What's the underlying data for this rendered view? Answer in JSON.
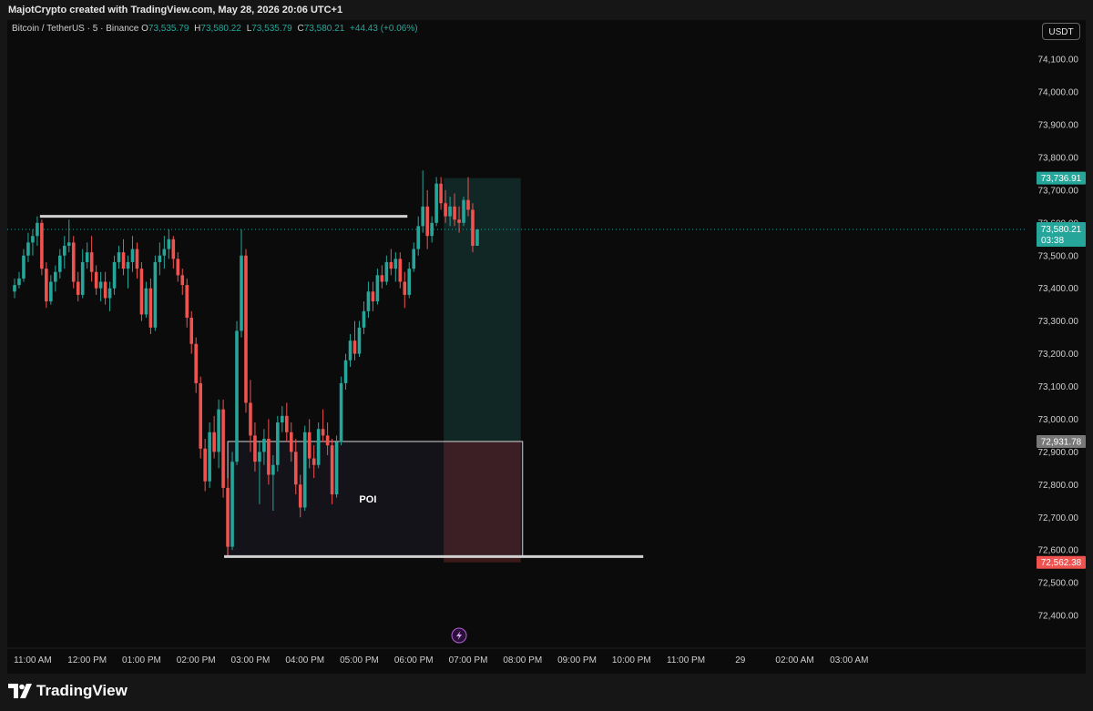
{
  "header": {
    "attribution": "MajotCrypto created with TradingView.com, May 28, 2026 20:06 UTC+1"
  },
  "legend": {
    "symbol": "Bitcoin / TetherUS · 5 · Binance",
    "open_label": "O",
    "open": "73,535.79",
    "high_label": "H",
    "high": "73,580.22",
    "low_label": "L",
    "low": "73,535.79",
    "close_label": "C",
    "close": "73,580.21",
    "change": "+44.43 (+0.06%)"
  },
  "currency_button": "USDT",
  "footer": {
    "brand": "TradingView"
  },
  "colors": {
    "up": "#26a69a",
    "down": "#ef5350",
    "background": "#0b0b0b",
    "axis_text": "#cfcfcf"
  },
  "chart_data": {
    "type": "candlestick",
    "ylim": [
      72300,
      74220
    ],
    "y_ticks": [
      74100,
      74000,
      73900,
      73800,
      73700,
      73600,
      73500,
      73400,
      73300,
      73200,
      73100,
      73000,
      72900,
      72800,
      72700,
      72600,
      72500,
      72400
    ],
    "y_tick_labels": [
      "74,100.00",
      "74,000.00",
      "73,900.00",
      "73,800.00",
      "73,700.00",
      "73,600.00",
      "73,500.00",
      "73,400.00",
      "73,300.00",
      "73,200.00",
      "73,100.00",
      "73,000.00",
      "72,900.00",
      "72,800.00",
      "72,700.00",
      "72,600.00",
      "72,500.00",
      "72,400.00"
    ],
    "x_ticks": [
      "11:00 AM",
      "12:00 PM",
      "01:00 PM",
      "02:00 PM",
      "03:00 PM",
      "04:00 PM",
      "05:00 PM",
      "06:00 PM",
      "07:00 PM",
      "08:00 PM",
      "09:00 PM",
      "10:00 PM",
      "11:00 PM",
      "29",
      "02:00 AM",
      "03:00 AM"
    ],
    "interval": "5m",
    "start_time": "10:40 AM",
    "candles": [
      [
        73390,
        73430,
        73370,
        73410
      ],
      [
        73410,
        73450,
        73400,
        73430
      ],
      [
        73430,
        73520,
        73420,
        73500
      ],
      [
        73500,
        73570,
        73480,
        73540
      ],
      [
        73540,
        73580,
        73500,
        73560
      ],
      [
        73560,
        73620,
        73530,
        73600
      ],
      [
        73600,
        73610,
        73440,
        73460
      ],
      [
        73460,
        73480,
        73340,
        73360
      ],
      [
        73360,
        73440,
        73350,
        73420
      ],
      [
        73420,
        73470,
        73390,
        73450
      ],
      [
        73450,
        73520,
        73430,
        73500
      ],
      [
        73500,
        73560,
        73460,
        73530
      ],
      [
        73530,
        73610,
        73510,
        73540
      ],
      [
        73540,
        73560,
        73400,
        73420
      ],
      [
        73420,
        73450,
        73360,
        73380
      ],
      [
        73380,
        73520,
        73370,
        73480
      ],
      [
        73480,
        73540,
        73460,
        73510
      ],
      [
        73510,
        73560,
        73420,
        73450
      ],
      [
        73450,
        73470,
        73380,
        73400
      ],
      [
        73400,
        73450,
        73360,
        73420
      ],
      [
        73420,
        73450,
        73350,
        73370
      ],
      [
        73370,
        73420,
        73330,
        73400
      ],
      [
        73400,
        73500,
        73380,
        73480
      ],
      [
        73480,
        73530,
        73460,
        73510
      ],
      [
        73510,
        73550,
        73440,
        73460
      ],
      [
        73460,
        73500,
        73400,
        73480
      ],
      [
        73480,
        73560,
        73450,
        73520
      ],
      [
        73520,
        73540,
        73430,
        73460
      ],
      [
        73460,
        73480,
        73300,
        73320
      ],
      [
        73320,
        73420,
        73310,
        73400
      ],
      [
        73400,
        73430,
        73260,
        73280
      ],
      [
        73280,
        73500,
        73270,
        73480
      ],
      [
        73480,
        73540,
        73440,
        73500
      ],
      [
        73500,
        73560,
        73460,
        73520
      ],
      [
        73520,
        73580,
        73490,
        73550
      ],
      [
        73550,
        73560,
        73460,
        73490
      ],
      [
        73490,
        73510,
        73420,
        73440
      ],
      [
        73440,
        73460,
        73380,
        73410
      ],
      [
        73410,
        73430,
        73280,
        73310
      ],
      [
        73310,
        73330,
        73200,
        73230
      ],
      [
        73230,
        73250,
        73080,
        73110
      ],
      [
        73110,
        73130,
        72880,
        72910
      ],
      [
        72910,
        72940,
        72780,
        72810
      ],
      [
        72810,
        72990,
        72790,
        72960
      ],
      [
        72960,
        73010,
        72880,
        72900
      ],
      [
        72900,
        73060,
        72850,
        73030
      ],
      [
        73030,
        73060,
        72760,
        72790
      ],
      [
        72790,
        72820,
        72580,
        72610
      ],
      [
        72610,
        72900,
        72600,
        72870
      ],
      [
        72870,
        73300,
        72860,
        73270
      ],
      [
        73270,
        73580,
        73250,
        73500
      ],
      [
        73500,
        73520,
        73020,
        73050
      ],
      [
        73050,
        73120,
        72900,
        72950
      ],
      [
        72950,
        72990,
        72840,
        72870
      ],
      [
        72870,
        72930,
        72740,
        72900
      ],
      [
        72900,
        72970,
        72860,
        72940
      ],
      [
        72940,
        73000,
        72800,
        72830
      ],
      [
        72830,
        72890,
        72720,
        72860
      ],
      [
        72860,
        73010,
        72840,
        72990
      ],
      [
        72990,
        73040,
        72960,
        73010
      ],
      [
        73010,
        73050,
        72930,
        72960
      ],
      [
        72960,
        72990,
        72870,
        72900
      ],
      [
        72900,
        72940,
        72770,
        72800
      ],
      [
        72800,
        72830,
        72700,
        72730
      ],
      [
        72730,
        72980,
        72720,
        72960
      ],
      [
        72960,
        73000,
        72850,
        72880
      ],
      [
        72880,
        72920,
        72820,
        72860
      ],
      [
        72860,
        72990,
        72850,
        72970
      ],
      [
        72970,
        73030,
        72930,
        72950
      ],
      [
        72950,
        72990,
        72890,
        72920
      ],
      [
        72920,
        72940,
        72740,
        72770
      ],
      [
        72770,
        72950,
        72760,
        72930
      ],
      [
        72930,
        73130,
        72920,
        73110
      ],
      [
        73110,
        73200,
        73090,
        73180
      ],
      [
        73180,
        73260,
        73160,
        73240
      ],
      [
        73240,
        73300,
        73180,
        73200
      ],
      [
        73200,
        73300,
        73190,
        73280
      ],
      [
        73280,
        73360,
        73260,
        73330
      ],
      [
        73330,
        73420,
        73310,
        73390
      ],
      [
        73390,
        73420,
        73330,
        73360
      ],
      [
        73360,
        73460,
        73350,
        73440
      ],
      [
        73440,
        73470,
        73400,
        73420
      ],
      [
        73420,
        73500,
        73410,
        73480
      ],
      [
        73480,
        73520,
        73440,
        73460
      ],
      [
        73460,
        73510,
        73420,
        73490
      ],
      [
        73490,
        73510,
        73400,
        73420
      ],
      [
        73420,
        73450,
        73340,
        73380
      ],
      [
        73380,
        73480,
        73370,
        73460
      ],
      [
        73460,
        73540,
        73450,
        73520
      ],
      [
        73520,
        73620,
        73500,
        73590
      ],
      [
        73590,
        73760,
        73570,
        73650
      ],
      [
        73650,
        73700,
        73520,
        73560
      ],
      [
        73560,
        73620,
        73540,
        73600
      ],
      [
        73600,
        73740,
        73590,
        73720
      ],
      [
        73720,
        73740,
        73640,
        73660
      ],
      [
        73660,
        73700,
        73600,
        73620
      ],
      [
        73620,
        73680,
        73590,
        73650
      ],
      [
        73650,
        73690,
        73590,
        73610
      ],
      [
        73610,
        73650,
        73570,
        73600
      ],
      [
        73600,
        73680,
        73590,
        73670
      ],
      [
        73670,
        73740,
        73620,
        73640
      ],
      [
        73640,
        73660,
        73510,
        73530
      ],
      [
        73530,
        73580,
        73530,
        73580
      ]
    ],
    "last_price": "73,580.21",
    "countdown": "03:38",
    "poi_box": {
      "label": "POI",
      "top": 72931.78,
      "bottom": 72580,
      "start_index": 47,
      "end_index": 112
    },
    "resistance_line": {
      "price": 73620,
      "start_index": 6,
      "end_index": 87
    },
    "support_line": {
      "price": 72580,
      "start_index": 47,
      "end_index": 139
    },
    "position": {
      "entry": 72931.78,
      "target": 73736.91,
      "stop": 72562.38,
      "start_index": 95,
      "end_index": 107
    },
    "price_labels": [
      {
        "value": "73,736.91",
        "price": 73736.91,
        "color": "#26a69a"
      },
      {
        "value": "72,931.78",
        "price": 72931.78,
        "color": "#787878"
      },
      {
        "value": "72,562.38",
        "price": 72562.38,
        "color": "#ef5350"
      }
    ]
  }
}
